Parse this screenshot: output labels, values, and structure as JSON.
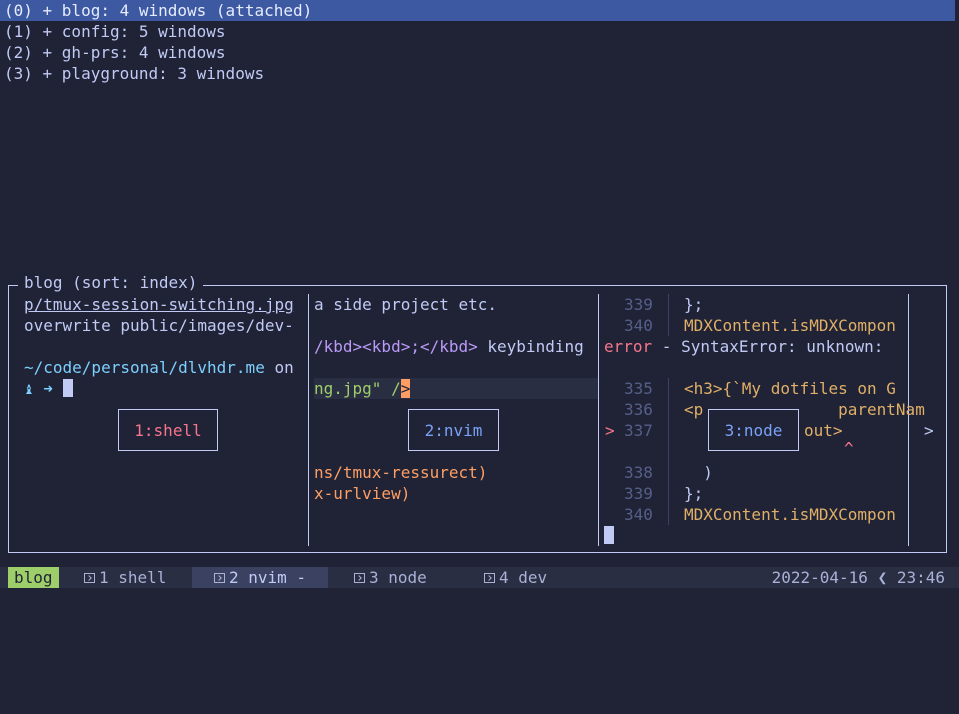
{
  "sessions": [
    {
      "text": "(0) + blog: 4 windows (attached)",
      "selected": true
    },
    {
      "text": "(1) + config: 5 windows",
      "selected": false
    },
    {
      "text": "(2) + gh-prs: 4 windows",
      "selected": false
    },
    {
      "text": "(3) + playground: 3 windows",
      "selected": false
    }
  ],
  "preview": {
    "title": "blog (sort: index)",
    "shell": {
      "label": "1:shell",
      "line1": "p/tmux-session-switching.jpg",
      "line2": "overwrite public/images/dev-",
      "line3": "~/code/personal/dlvhdr.me",
      "line3b": " on",
      "prompt_icon": "♝",
      "prompt_arrow": "➜"
    },
    "nvim": {
      "label": "2:nvim",
      "line1": "a side project etc.",
      "line2a": "/kbd><kbd>;</kbd>",
      "line2b": " keybinding",
      "line3a": "ng.jpg\" /",
      "line3b": ">",
      "line4": "ns/tmux-ressurect)",
      "line5": "x-urlview)"
    },
    "node": {
      "label": "3:node",
      "rows": [
        {
          "num": "339",
          "code": "};"
        },
        {
          "num": "340",
          "code": "MDXContent.isMDXCompon"
        },
        {
          "num": "335",
          "code": "<h3>{`My dotfiles on G"
        },
        {
          "num": "336",
          "code": "<p              parentNam"
        },
        {
          "num": "337",
          "code": "out>"
        },
        {
          "num": "338",
          "code": "  )"
        },
        {
          "num": "339",
          "code": "};"
        },
        {
          "num": "340",
          "code": "MDXContent.isMDXCompon"
        }
      ],
      "error_word": "error",
      "error_rest": " - SyntaxError: unknown:",
      "marker": ">",
      "caret": "^",
      "overflow": ">"
    }
  },
  "statusbar": {
    "session": "blog",
    "windows": [
      {
        "label": "1 shell"
      },
      {
        "label": "2 nvim -"
      },
      {
        "label": "3 node"
      },
      {
        "label": "4 dev"
      }
    ],
    "datetime": "2022-04-16 ❮ 23:46"
  }
}
